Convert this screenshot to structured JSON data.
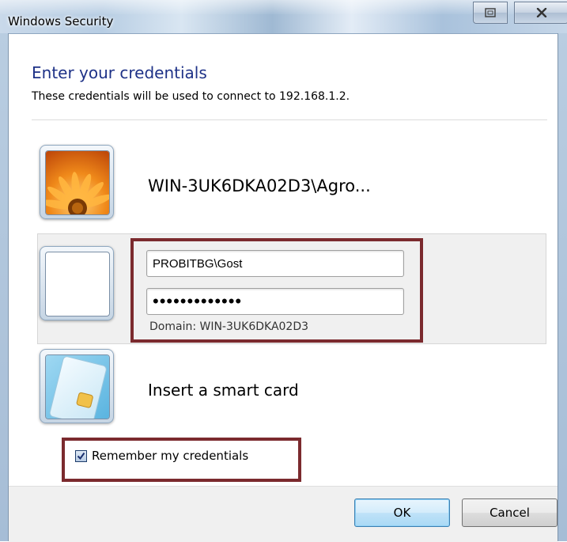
{
  "window": {
    "title": "Windows Security"
  },
  "dialog": {
    "heading": "Enter your credentials",
    "subtext": "These credentials will be used to connect to 192.168.1.2."
  },
  "saved_account": {
    "name": "WIN-3UK6DKA02D3\\Agro...",
    "icon": "flower-user-picture-icon"
  },
  "credentials": {
    "username_value": "PROBITBG\\Gost",
    "password_value": "•••••••••••••",
    "domain_label": "Domain: WIN-3UK6DKA02D3",
    "icon": "blank-user-tile-icon"
  },
  "smartcard": {
    "label": "Insert a smart card",
    "icon": "smart-card-icon"
  },
  "remember": {
    "label": "Remember my credentials",
    "checked": true
  },
  "buttons": {
    "ok": "OK",
    "cancel": "Cancel"
  },
  "colors": {
    "heading": "#1e3287",
    "highlight_border": "#7b2a2e",
    "ok_button_border": "#3c7fb1"
  }
}
